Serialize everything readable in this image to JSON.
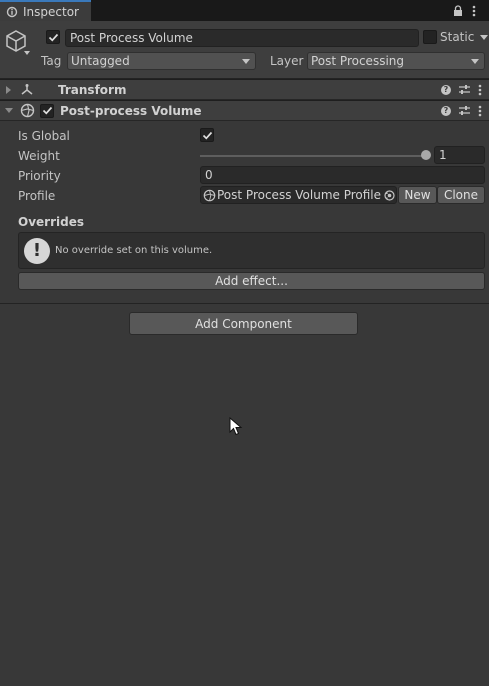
{
  "tab": {
    "label": "Inspector"
  },
  "header": {
    "object_name": "Post Process Volume",
    "static_label": "Static",
    "tag_label": "Tag",
    "tag_value": "Untagged",
    "layer_label": "Layer",
    "layer_value": "Post Processing",
    "active_checked": true
  },
  "components": {
    "transform": {
      "title": "Transform"
    },
    "volume": {
      "title": "Post-process Volume",
      "enabled": true,
      "props": {
        "is_global_label": "Is Global",
        "is_global": true,
        "weight_label": "Weight",
        "weight_value": "1",
        "weight_fraction": 1.0,
        "priority_label": "Priority",
        "priority_value": "0",
        "profile_label": "Profile",
        "profile_value": "Post Process Volume Profile :",
        "new_label": "New",
        "clone_label": "Clone"
      },
      "overrides_title": "Overrides",
      "overrides_message": "No override set on this volume.",
      "add_effect_label": "Add effect..."
    }
  },
  "add_component_label": "Add Component",
  "icons": [
    "lock-icon",
    "menu-icon",
    "cube-icon",
    "transform-icon",
    "volume-icon",
    "help-icon",
    "preset-icon",
    "warning-icon",
    "object-picker-icon",
    "cursor-icon"
  ]
}
